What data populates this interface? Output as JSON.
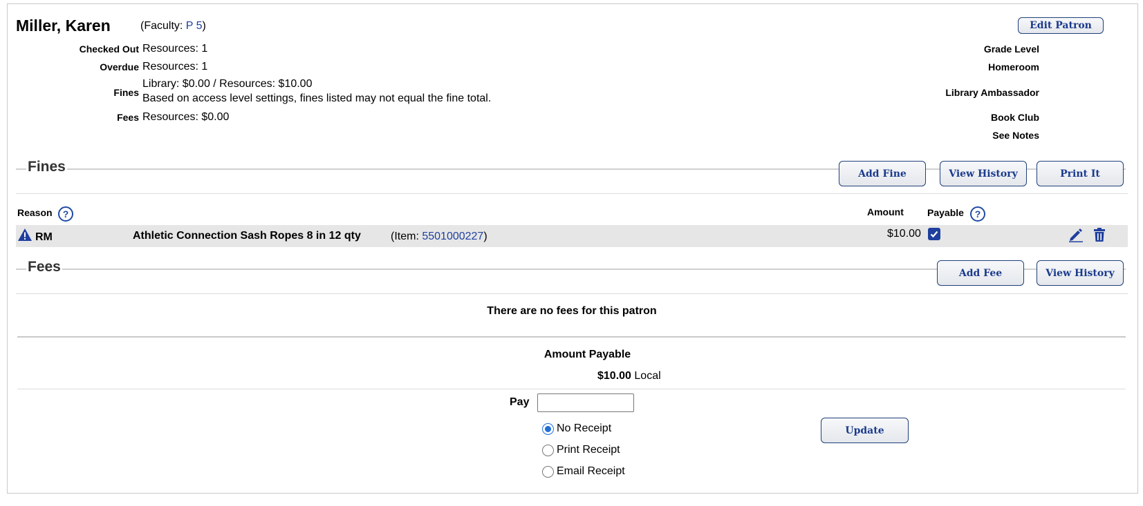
{
  "patron": {
    "name": "Miller, Karen",
    "faculty_prefix": "(Faculty: ",
    "faculty_link": "P 5",
    "faculty_suffix": ")",
    "edit_button": "Edit Patron"
  },
  "summary": {
    "checked_out_label": "Checked Out",
    "checked_out_value": "Resources: 1",
    "overdue_label": "Overdue",
    "overdue_value": "Resources: 1",
    "fines_label": "Fines",
    "fines_value": "Library: $0.00 / Resources: $10.00",
    "fines_note": "Based on access level settings, fines listed may not equal the fine total.",
    "fees_label": "Fees",
    "fees_value": "Resources: $0.00"
  },
  "attributes": [
    "Grade Level",
    "Homeroom",
    "Library Ambassador",
    "Book Club",
    "See Notes"
  ],
  "fines_section": {
    "title": "Fines",
    "add_button": "Add Fine",
    "history_button": "View History",
    "print_button": "Print It",
    "columns": {
      "reason": "Reason",
      "amount": "Amount",
      "payable": "Payable"
    },
    "rows": [
      {
        "reason_code": "RM",
        "title": "Athletic Connection Sash Ropes 8 in 12 qty",
        "item_prefix": "(Item: ",
        "item_barcode": "5501000227",
        "item_suffix": ")",
        "amount": "$10.00",
        "payable": true
      }
    ]
  },
  "fees_section": {
    "title": "Fees",
    "add_button": "Add Fee",
    "history_button": "View History",
    "empty_message": "There are no fees for this patron"
  },
  "payment": {
    "amount_payable_label": "Amount Payable",
    "amount": "$10.00",
    "currency_note": "Local",
    "pay_label": "Pay",
    "pay_value": "",
    "update_button": "Update",
    "receipt_options": [
      {
        "label": "No Receipt",
        "selected": true
      },
      {
        "label": "Print Receipt",
        "selected": false
      },
      {
        "label": "Email Receipt",
        "selected": false
      }
    ]
  },
  "colors": {
    "link": "#1f3f9e",
    "button_text": "#1a3a8c",
    "row_highlight": "#e6e6e6"
  },
  "icons": {
    "warning": "warning-triangle-icon",
    "help": "question-circle-icon",
    "edit": "pencil-icon",
    "delete": "trash-icon",
    "checkbox": "checkbox-checked-icon"
  }
}
